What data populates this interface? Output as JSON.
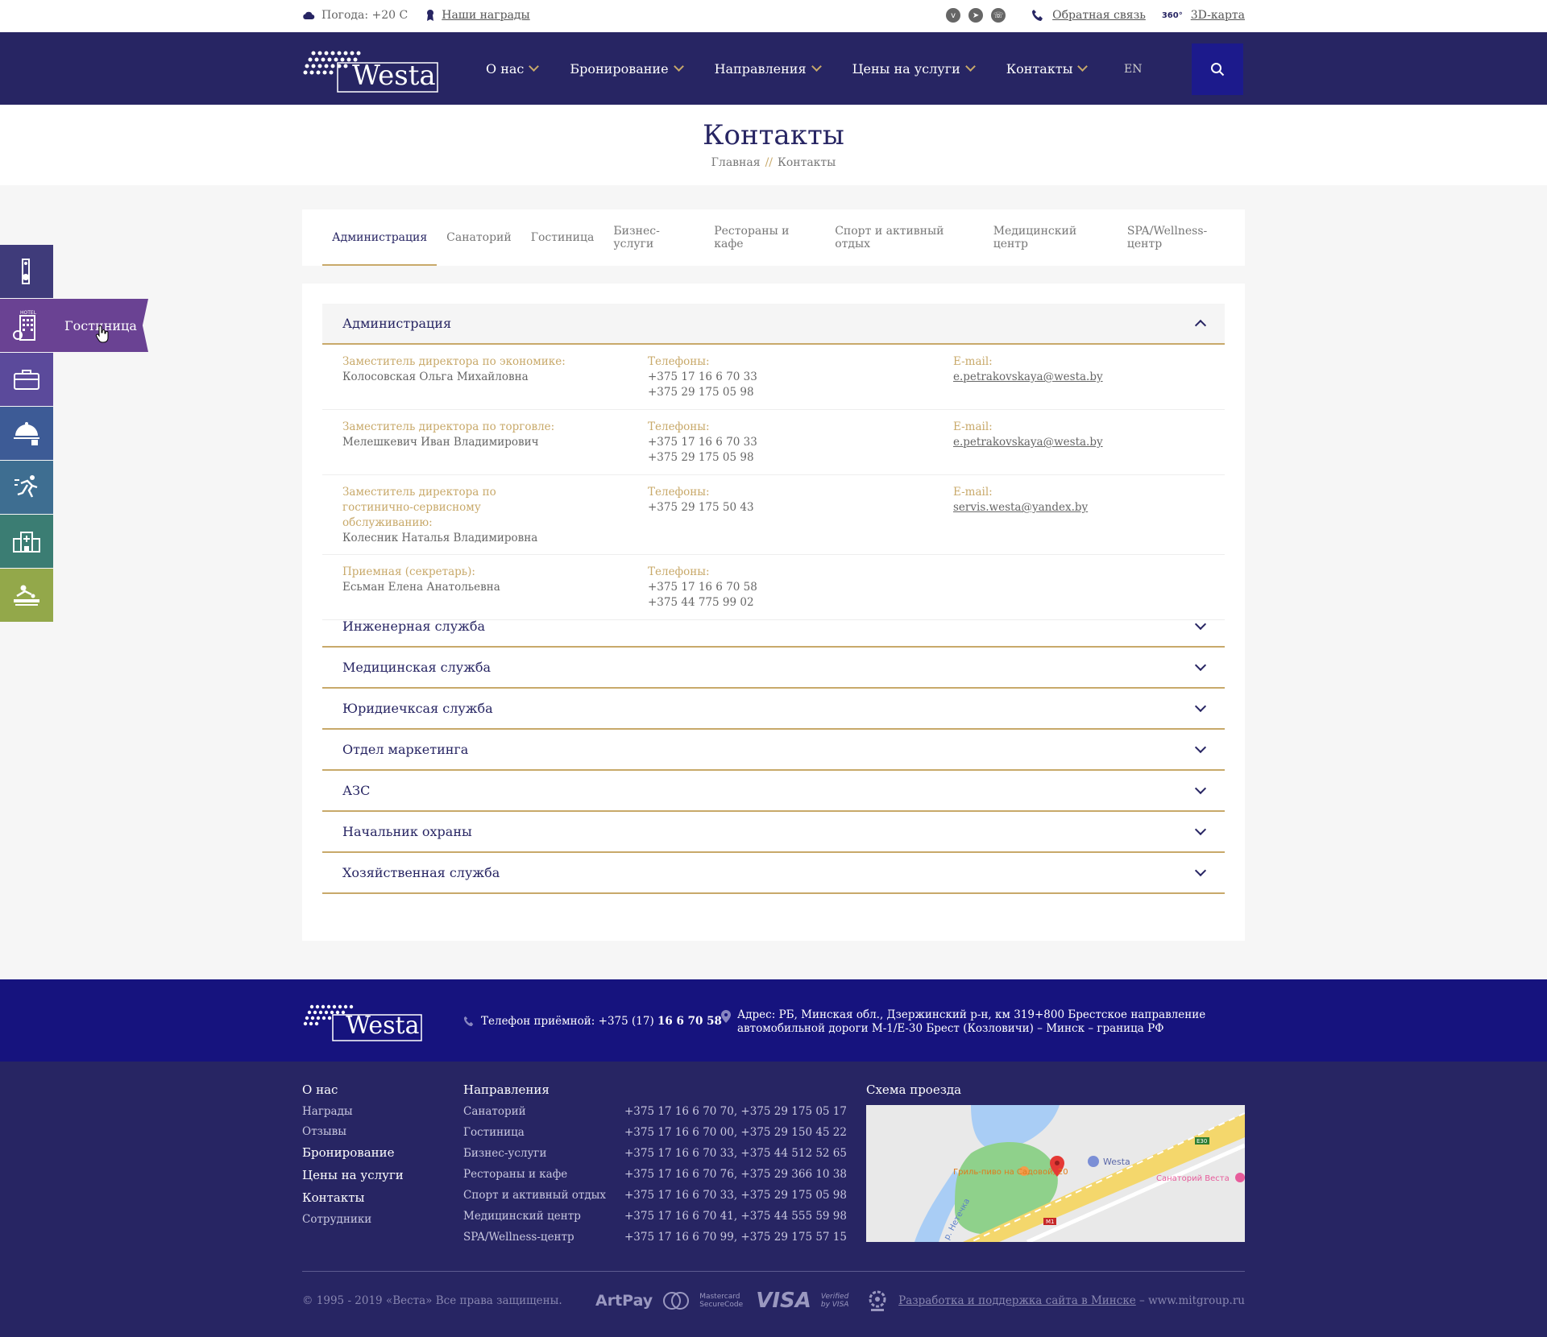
{
  "topbar": {
    "weather": "Погода: +20 С",
    "awards": "Наши награды",
    "feedback": "Обратная связь",
    "map3d": "3D-карта",
    "icon_360": "360°"
  },
  "header": {
    "logo": "Westa",
    "nav": [
      "О нас",
      "Бронирование",
      "Направления",
      "Цены на услуги",
      "Контакты"
    ],
    "lang": "EN"
  },
  "page": {
    "title": "Контакты",
    "breadcrumb_home": "Главная",
    "breadcrumb_sep": "//",
    "breadcrumb_current": "Контакты"
  },
  "tabs": [
    "Администрация",
    "Санаторий",
    "Гостиница",
    "Бизнес-услуги",
    "Рестораны и кафе",
    "Спорт и активный отдых",
    "Медицинский центр",
    "SPA/Wellness-центр"
  ],
  "contacts": {
    "open_section": "Администрация",
    "phones_label": "Телефоны:",
    "email_label": "E-mail:",
    "rows": [
      {
        "position": "Заместитель директора по экономике:",
        "name": "Колосовская Ольга Михайловна",
        "phone1": "+375 17 16 6 70 33",
        "phone2": "+375 29 175 05 98",
        "email": "e.petrakovskaya@westa.by"
      },
      {
        "position": "Заместитель директора по торговле:",
        "name": "Мелешкевич Иван Владимирович",
        "phone1": "+375 17 16 6 70 33",
        "phone2": "+375 29 175 05 98",
        "email": "e.petrakovskaya@westa.by"
      },
      {
        "position": "Заместитель директора по гостинично-сервисному обслуживанию:",
        "name": "Колесник Наталья Владимировна",
        "phone1": "+375 29 175 50 43",
        "phone2": "",
        "email": "servis.westa@yandex.by"
      },
      {
        "position": "Приемная (секретарь):",
        "name": "Есьман Елена Анатольевна",
        "phone1": "+375 17 16 6 70 58",
        "phone2": "+375 44 775 99 02",
        "email": ""
      }
    ],
    "closed_sections": [
      "Инженерная служба",
      "Медицинская служба",
      "Юридиечксая служба",
      "Отдел маркетинга",
      "АЗС",
      "Начальник охраны",
      "Хозяйственная служба"
    ]
  },
  "sidebar": {
    "active_label": "Гостиница",
    "hotel_icon_text": "HOTEL",
    "items": [
      {
        "icon": "door-hanger-icon",
        "color": "#3f3b7a"
      },
      {
        "icon": "hotel-icon",
        "color": "#6a4293"
      },
      {
        "icon": "briefcase-icon",
        "color": "#5b4a9b"
      },
      {
        "icon": "cloche-icon",
        "color": "#3d5b96"
      },
      {
        "icon": "running-icon",
        "color": "#3e6e91"
      },
      {
        "icon": "hospital-icon",
        "color": "#3b7d73"
      },
      {
        "icon": "massage-icon",
        "color": "#93a84a"
      }
    ]
  },
  "footer": {
    "logo": "Westa",
    "phone_label": "Телефон приёмной: +375 (17)",
    "phone_bold": "16 6 70 58",
    "address": "Адрес: РБ, Минская обл., Дзержинский р-н, км 319+800 Брестское направление автомобильной дороги М-1/Е-30 Брест (Козловичи) – Минск – граница РФ",
    "menu": [
      {
        "label": "О нас",
        "big": true
      },
      {
        "label": "Награды",
        "big": false
      },
      {
        "label": "Отзывы",
        "big": false
      },
      {
        "label": "Бронирование",
        "big": true
      },
      {
        "label": "Цены на услуги",
        "big": true
      },
      {
        "label": "Контакты",
        "big": true
      },
      {
        "label": "Сотрудники",
        "big": false
      }
    ],
    "directions_title": "Направления",
    "directions": [
      {
        "name": "Санаторий",
        "phones": "+375 17 16 6 70 70, +375 29 175 05 17"
      },
      {
        "name": "Гостиница",
        "phones": "+375 17 16 6 70 00, +375 29 150 45 22"
      },
      {
        "name": "Бизнес-услуги",
        "phones": "+375 17 16 6 70 33, +375 44 512 52 65"
      },
      {
        "name": "Рестораны и кафе",
        "phones": "+375 17 16 6 70 76, +375 29 366 10 38"
      },
      {
        "name": "Спорт и активный отдых",
        "phones": "+375 17 16 6 70 33, +375 29 175 05 98"
      },
      {
        "name": "Медицинский центр",
        "phones": "+375 17 16 6 70 41, +375 44 555 59 98"
      },
      {
        "name": "SPA/Wellness-центр",
        "phones": "+375 17 16 6 70 99, +375 29 175 57 15"
      }
    ],
    "map_title": "Схема проезда",
    "map": {
      "westa": "Westa",
      "grill": "Гриль-пиво на Садовой, 20",
      "sanatorium": "Санаторий Веста",
      "river": "р. Нетечка",
      "road_m1": "M1",
      "road_e30": "E30"
    },
    "copyright": "© 1995 - 2019 «Веста» Все права защищены.",
    "payments": [
      "ArtPay",
      "Mastercard SecureCode",
      "VISA",
      "Verified by VISA"
    ],
    "dev_link": "Разработка и поддержка сайта в Минске",
    "dev_suffix": " – www.mitgroup.ru"
  }
}
